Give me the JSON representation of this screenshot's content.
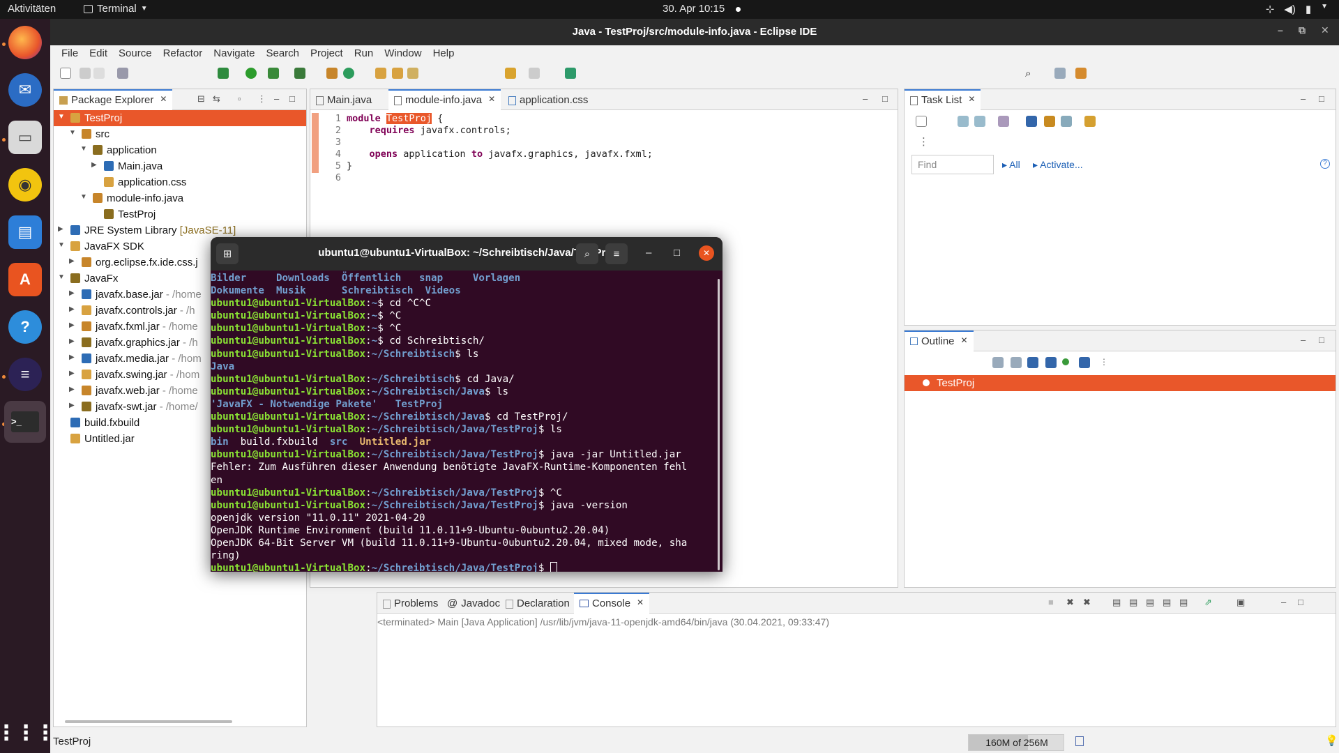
{
  "topbar": {
    "activities": "Aktivitäten",
    "app": "Terminal",
    "clock": "30. Apr  10:15"
  },
  "window": {
    "title": "Java - TestProj/src/module-info.java - Eclipse IDE"
  },
  "menu": [
    "File",
    "Edit",
    "Source",
    "Refactor",
    "Navigate",
    "Search",
    "Project",
    "Run",
    "Window",
    "Help"
  ],
  "package_explorer": {
    "tab": "Package Explorer",
    "tree": [
      {
        "label": "TestProj",
        "depth": 0,
        "twisty": "▼",
        "selected": true
      },
      {
        "label": "src",
        "depth": 1,
        "twisty": "▼"
      },
      {
        "label": "application",
        "depth": 2,
        "twisty": "▼"
      },
      {
        "label": "Main.java",
        "depth": 3,
        "twisty": "▶"
      },
      {
        "label": "application.css",
        "depth": 3,
        "twisty": ""
      },
      {
        "label": "module-info.java",
        "depth": 2,
        "twisty": "▼"
      },
      {
        "label": "TestProj",
        "depth": 3,
        "twisty": ""
      },
      {
        "label": "JRE System Library",
        "deco": "[JavaSE-11]",
        "depth": 0,
        "twisty": "▶"
      },
      {
        "label": "JavaFX SDK",
        "depth": 0,
        "twisty": "▼"
      },
      {
        "label": "org.eclipse.fx.ide.css.j",
        "depth": 1,
        "twisty": "▶"
      },
      {
        "label": "JavaFx",
        "depth": 0,
        "twisty": "▼"
      },
      {
        "label": "javafx.base.jar",
        "deco": " - /home",
        "depth": 1,
        "twisty": "▶"
      },
      {
        "label": "javafx.controls.jar",
        "deco": " - /h",
        "depth": 1,
        "twisty": "▶"
      },
      {
        "label": "javafx.fxml.jar",
        "deco": " - /home",
        "depth": 1,
        "twisty": "▶"
      },
      {
        "label": "javafx.graphics.jar",
        "deco": " - /h",
        "depth": 1,
        "twisty": "▶"
      },
      {
        "label": "javafx.media.jar",
        "deco": " - /hom",
        "depth": 1,
        "twisty": "▶"
      },
      {
        "label": "javafx.swing.jar",
        "deco": " - /hom",
        "depth": 1,
        "twisty": "▶"
      },
      {
        "label": "javafx.web.jar",
        "deco": " - /home",
        "depth": 1,
        "twisty": "▶"
      },
      {
        "label": "javafx-swt.jar",
        "deco": " - /home/",
        "depth": 1,
        "twisty": "▶"
      },
      {
        "label": "build.fxbuild",
        "depth": 0,
        "twisty": ""
      },
      {
        "label": "Untitled.jar",
        "depth": 0,
        "twisty": ""
      }
    ]
  },
  "editor": {
    "tabs": [
      "Main.java",
      "module-info.java",
      "application.css"
    ],
    "lines": [
      {
        "n": "1",
        "kw": "module",
        "rest": " ",
        "hl": "TestProj",
        "tail": " {"
      },
      {
        "n": "2",
        "kw": "    requires",
        "rest": " javafx.controls;",
        "hl": "",
        "tail": ""
      },
      {
        "n": "3",
        "kw": "",
        "rest": "",
        "hl": "",
        "tail": ""
      },
      {
        "n": "4",
        "kw": "    opens",
        "rest": " application ",
        "hl": "",
        "tail": "to javafx.graphics, javafx.fxml;",
        "kw2": "to"
      },
      {
        "n": "5",
        "kw": "",
        "rest": "}",
        "hl": "",
        "tail": ""
      },
      {
        "n": "6",
        "kw": "",
        "rest": "",
        "hl": "",
        "tail": ""
      }
    ]
  },
  "tasklist": {
    "tab": "Task List",
    "find_placeholder": "Find",
    "all": "All",
    "activate": "Activate..."
  },
  "outline": {
    "tab": "Outline",
    "item": "TestProj"
  },
  "console": {
    "tabs": [
      "Problems",
      "Javadoc",
      "Declaration",
      "Console"
    ],
    "status": "<terminated> Main [Java Application] /usr/lib/jvm/java-11-openjdk-amd64/bin/java (30.04.2021, 09:33:47)"
  },
  "terminal": {
    "title": "ubuntu1@ubuntu1-VirtualBox: ~/Schreibtisch/Java/TestProj",
    "prompt_user": "ubuntu1@ubuntu1-VirtualBox",
    "lines": [
      {
        "type": "dirs",
        "text": "Bilder     Downloads  Öffentlich   snap     Vorlagen"
      },
      {
        "type": "dirs",
        "text": "Dokumente  Musik      Schreibtisch  Videos"
      },
      {
        "type": "cmd",
        "path": "~",
        "cmd": " cd ^C^C"
      },
      {
        "type": "cmd",
        "path": "~",
        "cmd": " ^C"
      },
      {
        "type": "cmd",
        "path": "~",
        "cmd": " ^C"
      },
      {
        "type": "cmd",
        "path": "~",
        "cmd": " cd Schreibtisch/"
      },
      {
        "type": "cmd",
        "path": "~/Schreibtisch",
        "cmd": " ls"
      },
      {
        "type": "dirs",
        "text": "Java"
      },
      {
        "type": "cmd",
        "path": "~/Schreibtisch",
        "cmd": " cd Java/"
      },
      {
        "type": "cmd",
        "path": "~/Schreibtisch/Java",
        "cmd": " ls"
      },
      {
        "type": "dirs",
        "text": "'JavaFX - Notwendige Pakete'   TestProj"
      },
      {
        "type": "cmd",
        "path": "~/Schreibtisch/Java",
        "cmd": " cd TestProj/"
      },
      {
        "type": "cmd",
        "path": "~/Schreibtisch/Java/TestProj",
        "cmd": " ls"
      },
      {
        "type": "ls",
        "text": ""
      },
      {
        "type": "cmd",
        "path": "~/Schreibtisch/Java/TestProj",
        "cmd": " java -jar Untitled.jar"
      },
      {
        "type": "out",
        "text": "Fehler: Zum Ausführen dieser Anwendung benötigte JavaFX-Runtime-Komponenten fehl"
      },
      {
        "type": "out",
        "text": "en"
      },
      {
        "type": "cmd",
        "path": "~/Schreibtisch/Java/TestProj",
        "cmd": " ^C"
      },
      {
        "type": "cmd",
        "path": "~/Schreibtisch/Java/TestProj",
        "cmd": " java -version"
      },
      {
        "type": "out",
        "text": "openjdk version \"11.0.11\" 2021-04-20"
      },
      {
        "type": "out",
        "text": "OpenJDK Runtime Environment (build 11.0.11+9-Ubuntu-0ubuntu2.20.04)"
      },
      {
        "type": "out",
        "text": "OpenJDK 64-Bit Server VM (build 11.0.11+9-Ubuntu-0ubuntu2.20.04, mixed mode, sha"
      },
      {
        "type": "out",
        "text": "ring)"
      },
      {
        "type": "prompt",
        "path": "~/Schreibtisch/Java/TestProj",
        "cmd": " "
      }
    ],
    "ls_items": [
      {
        "text": "bin",
        "kind": "dir"
      },
      {
        "text": "  build.fxbuild  ",
        "kind": "file"
      },
      {
        "text": "src",
        "kind": "dir"
      },
      {
        "text": "  ",
        "kind": "file"
      },
      {
        "text": "Untitled.jar",
        "kind": "jar"
      }
    ]
  },
  "statusbar": {
    "left": "TestProj",
    "memory": "160M of 256M"
  },
  "colors": {
    "selection": "#e9572a",
    "terminal_bg": "#300a24",
    "prompt_user": "#8ae234",
    "prompt_path": "#729fcf"
  }
}
